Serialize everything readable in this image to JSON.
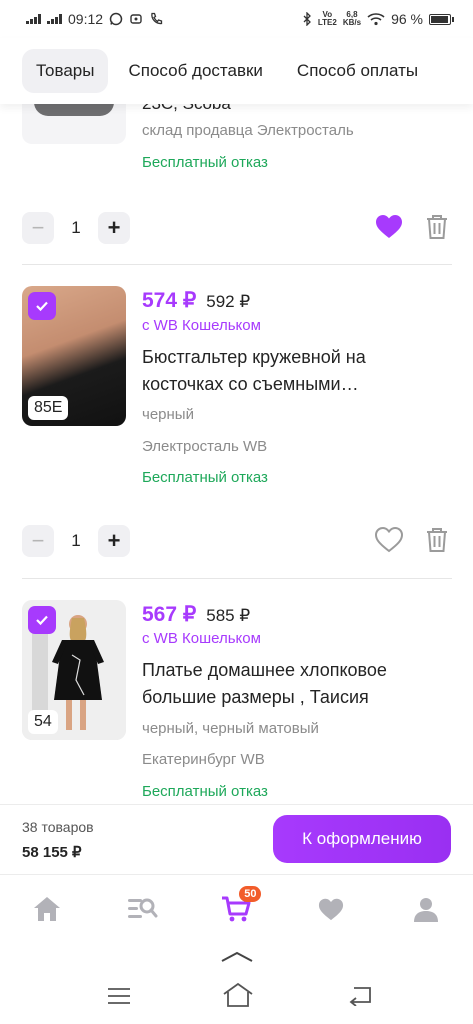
{
  "status": {
    "time": "09:12",
    "net_top": "Vo",
    "net_bottom": "LTE2",
    "speed_top": "6,8",
    "speed_bottom": "KB/s",
    "battery": "96 %"
  },
  "tabs": [
    "Товары",
    "Способ доставки",
    "Способ оплаты"
  ],
  "partial_item": {
    "title_fragment": "23С, Scoba",
    "warehouse": "склад продавца Электросталь",
    "return_text": "Бесплатный отказ",
    "quantity": "1",
    "favorited": true
  },
  "items": [
    {
      "price": "574 ₽",
      "old_price": "592 ₽",
      "wallet": "с WB Кошельком",
      "title_line1": "Бюстгальтер кружевной на",
      "title_line2": "косточках со съемными…",
      "color": "черный",
      "warehouse": "Электросталь WB",
      "return_text": "Бесплатный отказ",
      "size": "85E",
      "quantity": "1",
      "favorited": false
    },
    {
      "price": "567 ₽",
      "old_price": "585 ₽",
      "wallet": "с WB Кошельком",
      "title_line1": "Платье домашнее хлопковое",
      "title_line2": "большие размеры , Таисия",
      "color": "черный, черный матовый",
      "warehouse": "Екатеринбург WB",
      "return_text": "Бесплатный отказ",
      "size": "54",
      "quantity": "1"
    }
  ],
  "summary": {
    "count": "38 товаров",
    "total": "58 155 ₽",
    "checkout": "К оформлению"
  },
  "nav": {
    "cart_badge": "50"
  },
  "colors": {
    "accent": "#a73afd",
    "green": "#1ea85a",
    "badge": "#f25c2a"
  },
  "icons": [
    "home-icon",
    "search-catalog-icon",
    "cart-icon",
    "heart-icon",
    "profile-icon",
    "trash-icon",
    "menu-icon",
    "home-outline-icon",
    "back-icon",
    "chevron-up-icon"
  ]
}
